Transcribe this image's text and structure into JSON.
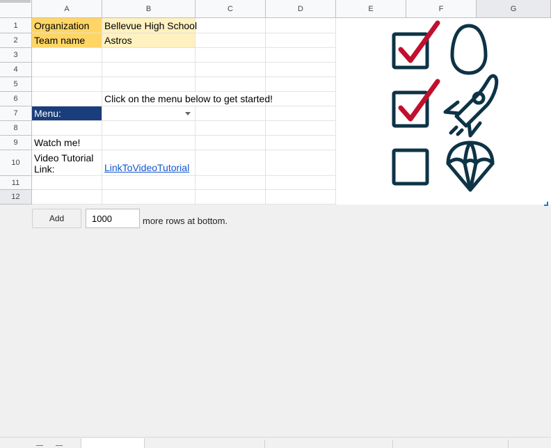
{
  "columns": [
    "A",
    "B",
    "C",
    "D",
    "E",
    "F",
    "G"
  ],
  "selected_column": "G",
  "rows": [
    "1",
    "2",
    "3",
    "4",
    "5",
    "6",
    "7",
    "8",
    "9",
    "10",
    "11",
    "12"
  ],
  "selected_row": "12",
  "cells": {
    "a1": "Organization",
    "b1": "Bellevue High School",
    "a2": "Team name",
    "b2": "Astros",
    "b6": "Click on the menu below to get started!",
    "a7": "Menu:",
    "b7": "",
    "a9": "Watch me!",
    "a10": "Video Tutorial Link:",
    "b10": "LinkToVideoTutorial"
  },
  "add_rows": {
    "button_label": "Add",
    "count": "1000",
    "suffix_label": "more rows at bottom."
  },
  "image_icons": [
    "checked-box-icon",
    "egg-icon",
    "checked-box-icon",
    "rocket-icon",
    "empty-box-icon",
    "parachute-icon"
  ],
  "colors": {
    "header_orange": "#ffd666",
    "header_yellow": "#fff1c0",
    "menu_navy": "#1a3d7c",
    "icon_navy": "#0d3346",
    "check_red": "#c0102e",
    "link_blue": "#1155cc"
  }
}
